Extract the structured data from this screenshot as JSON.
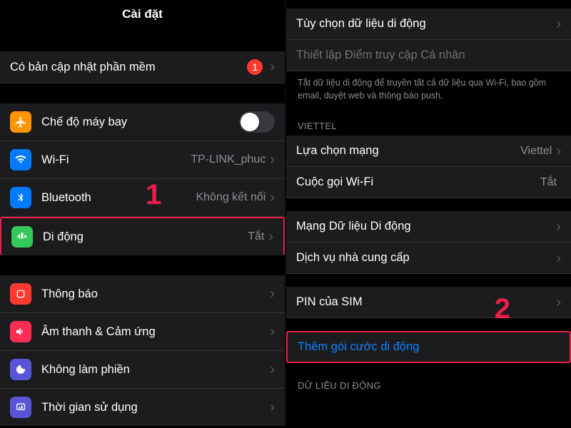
{
  "left": {
    "title": "Cài đặt",
    "software_update": {
      "label": "Có bản cập nhật phần mềm",
      "badge": "1"
    },
    "airplane": {
      "label": "Chế độ máy bay"
    },
    "wifi": {
      "label": "Wi-Fi",
      "value": "TP-LINK_phuc"
    },
    "bluetooth": {
      "label": "Bluetooth",
      "value": "Không kết nối"
    },
    "cellular": {
      "label": "Di động",
      "value": "Tắt"
    },
    "notifications": {
      "label": "Thông báo"
    },
    "sound": {
      "label": "Âm thanh & Cảm ứng"
    },
    "dnd": {
      "label": "Không làm phiền"
    },
    "screentime": {
      "label": "Thời gian sử dụng"
    },
    "step_label": "1"
  },
  "right": {
    "data_options": {
      "label": "Tùy chọn dữ liệu di động"
    },
    "hotspot": {
      "label": "Thiết lập Điểm truy cập Cá nhân"
    },
    "footnote": "Tắt dữ liệu di động để truyền tất cả dữ liệu qua Wi-Fi, bao gồm email, duyệt web và thông báo push.",
    "carrier_header": "VIETTEL",
    "network_selection": {
      "label": "Lựa chọn mạng",
      "value": "Viettel"
    },
    "wifi_calling": {
      "label": "Cuộc gọi Wi-Fi",
      "value": "Tắt"
    },
    "data_network": {
      "label": "Mạng Dữ liệu Di động"
    },
    "carrier_services": {
      "label": "Dịch vụ nhà cung cấp"
    },
    "sim_pin": {
      "label": "PIN của SIM"
    },
    "add_plan": {
      "label": "Thêm gói cước di động"
    },
    "data_header": "DỮ LIỆU DI ĐỘNG",
    "step_label": "2"
  }
}
